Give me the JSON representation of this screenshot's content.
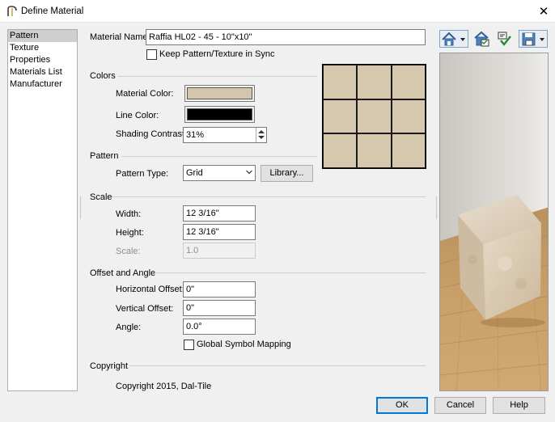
{
  "window": {
    "title": "Define Material",
    "close_glyph": "✕"
  },
  "sidebar": {
    "items": [
      {
        "label": "Pattern",
        "selected": true
      },
      {
        "label": "Texture"
      },
      {
        "label": "Properties"
      },
      {
        "label": "Materials List"
      },
      {
        "label": "Manufacturer"
      }
    ]
  },
  "material_name": {
    "label": "Material Name:",
    "value": "Raffia HL02 - 45 - 10\"x10\""
  },
  "keep_sync": {
    "label": "Keep Pattern/Texture in Sync",
    "checked": false
  },
  "colors": {
    "heading": "Colors",
    "material_color_label": "Material Color:",
    "material_color": "#d5c6ab",
    "line_color_label": "Line Color:",
    "line_color": "#000000",
    "shading_label": "Shading Contrast:",
    "shading_value": "31%"
  },
  "pattern": {
    "heading": "Pattern",
    "type_label": "Pattern Type:",
    "type_value": "Grid",
    "library_button": "Library..."
  },
  "scale": {
    "heading": "Scale",
    "width_label": "Width:",
    "width_value": "12 3/16\"",
    "height_label": "Height:",
    "height_value": "12 3/16\"",
    "scale_label": "Scale:",
    "scale_value": "1.0"
  },
  "offset": {
    "heading": "Offset and Angle",
    "horizontal_label": "Horizontal Offset:",
    "horizontal_value": "0\"",
    "vertical_label": "Vertical Offset:",
    "vertical_value": "0\"",
    "angle_label": "Angle:",
    "angle_value": "0.0°",
    "global_mapping_label": "Global Symbol Mapping",
    "global_mapping_checked": false
  },
  "copyright": {
    "heading": "Copyright",
    "text": "Copyright 2015, Dal-Tile"
  },
  "toolbar": {
    "icons": [
      "house-view-icon",
      "material-view-icon",
      "check-icon",
      "save-view-icon"
    ]
  },
  "buttons": {
    "ok": "OK",
    "cancel": "Cancel",
    "help": "Help"
  },
  "accent_color": "#0078d7"
}
